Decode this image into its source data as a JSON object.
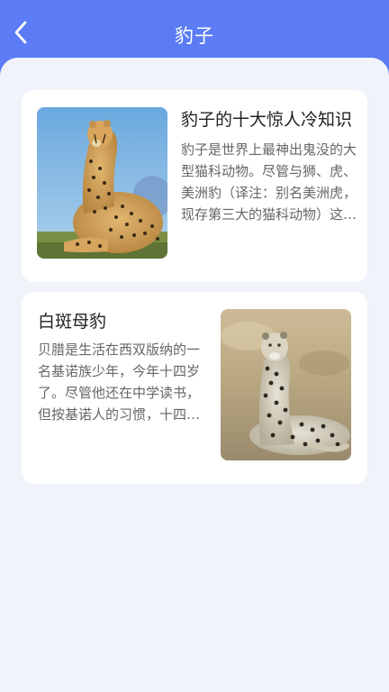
{
  "header": {
    "title": "豹子",
    "back_icon": "chevron-left-icon"
  },
  "colors": {
    "header_bg": "#5b7cf5",
    "content_bg": "#f0f3fa",
    "card_bg": "#ffffff"
  },
  "articles": [
    {
      "title": "豹子的十大惊人冷知识",
      "description": "豹子是世界上最神出鬼没的大型猫科动物。尽管与狮、虎、美洲豹（译注：别名美洲虎，现存第三大的猫科动物）这三类群…",
      "image": "cheetah-photo"
    },
    {
      "title": "白斑母豹",
      "description": "贝腊是生活在西双版纳的一名基诺族少年，今年十四岁了。尽管他还在中学读书，但按基诺人的习惯，十四岁就该成人了…",
      "image": "leopard-photo"
    }
  ]
}
